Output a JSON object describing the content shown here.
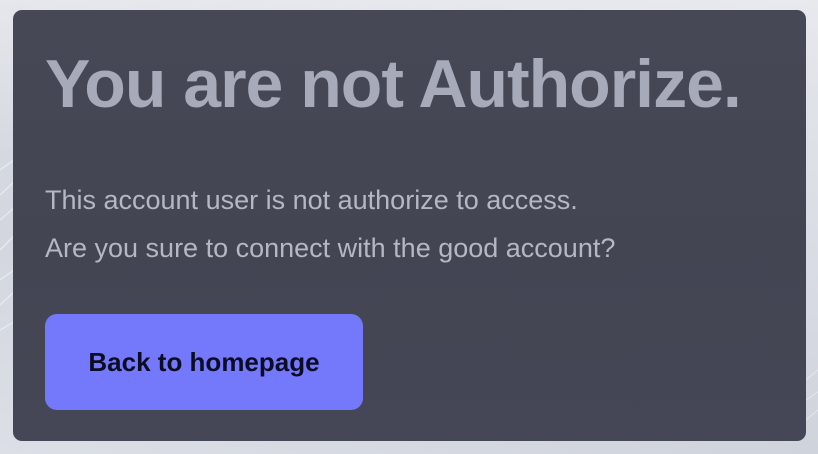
{
  "page": {
    "title": "You are not Authorize.",
    "message_lines": [
      "This account user is not authorize to access.",
      "Are you sure to connect with the good account?"
    ],
    "back_button_label": "Back to homepage"
  },
  "colors": {
    "card_background": "#454756",
    "title": "#a7aab8",
    "message": "#b4b7c4",
    "button_background": "#7479fb",
    "button_text": "#0c0d24"
  }
}
